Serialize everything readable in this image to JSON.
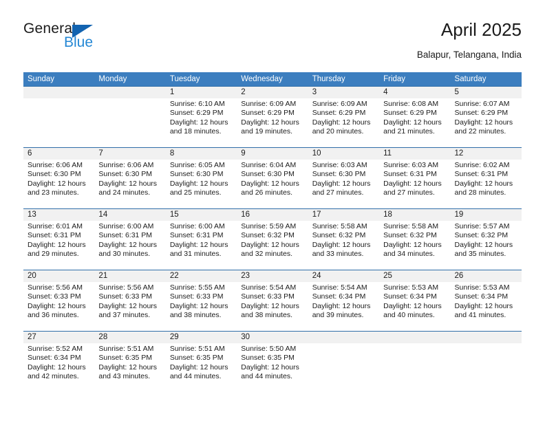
{
  "logo": {
    "word_one": "General",
    "word_two": "Blue",
    "triangle_color": "#1263b0",
    "blue_text_color": "#2487d4"
  },
  "header": {
    "title": "April 2025",
    "subtitle": "Balapur, Telangana, India"
  },
  "theme": {
    "header_blue": "#3c7ebf",
    "divider_blue": "#2f6da8",
    "number_band": "#f1f1f1",
    "text": "#1b1b1b"
  },
  "calendar": {
    "day_headers": [
      "Sunday",
      "Monday",
      "Tuesday",
      "Wednesday",
      "Thursday",
      "Friday",
      "Saturday"
    ],
    "weeks": [
      {
        "numbers": [
          "",
          "",
          "1",
          "2",
          "3",
          "4",
          "5"
        ],
        "cells": [
          {
            "sunrise": "",
            "sunset": "",
            "daylight_1": "",
            "daylight_2": ""
          },
          {
            "sunrise": "",
            "sunset": "",
            "daylight_1": "",
            "daylight_2": ""
          },
          {
            "sunrise": "Sunrise: 6:10 AM",
            "sunset": "Sunset: 6:29 PM",
            "daylight_1": "Daylight: 12 hours",
            "daylight_2": "and 18 minutes."
          },
          {
            "sunrise": "Sunrise: 6:09 AM",
            "sunset": "Sunset: 6:29 PM",
            "daylight_1": "Daylight: 12 hours",
            "daylight_2": "and 19 minutes."
          },
          {
            "sunrise": "Sunrise: 6:09 AM",
            "sunset": "Sunset: 6:29 PM",
            "daylight_1": "Daylight: 12 hours",
            "daylight_2": "and 20 minutes."
          },
          {
            "sunrise": "Sunrise: 6:08 AM",
            "sunset": "Sunset: 6:29 PM",
            "daylight_1": "Daylight: 12 hours",
            "daylight_2": "and 21 minutes."
          },
          {
            "sunrise": "Sunrise: 6:07 AM",
            "sunset": "Sunset: 6:29 PM",
            "daylight_1": "Daylight: 12 hours",
            "daylight_2": "and 22 minutes."
          }
        ]
      },
      {
        "numbers": [
          "6",
          "7",
          "8",
          "9",
          "10",
          "11",
          "12"
        ],
        "cells": [
          {
            "sunrise": "Sunrise: 6:06 AM",
            "sunset": "Sunset: 6:30 PM",
            "daylight_1": "Daylight: 12 hours",
            "daylight_2": "and 23 minutes."
          },
          {
            "sunrise": "Sunrise: 6:06 AM",
            "sunset": "Sunset: 6:30 PM",
            "daylight_1": "Daylight: 12 hours",
            "daylight_2": "and 24 minutes."
          },
          {
            "sunrise": "Sunrise: 6:05 AM",
            "sunset": "Sunset: 6:30 PM",
            "daylight_1": "Daylight: 12 hours",
            "daylight_2": "and 25 minutes."
          },
          {
            "sunrise": "Sunrise: 6:04 AM",
            "sunset": "Sunset: 6:30 PM",
            "daylight_1": "Daylight: 12 hours",
            "daylight_2": "and 26 minutes."
          },
          {
            "sunrise": "Sunrise: 6:03 AM",
            "sunset": "Sunset: 6:30 PM",
            "daylight_1": "Daylight: 12 hours",
            "daylight_2": "and 27 minutes."
          },
          {
            "sunrise": "Sunrise: 6:03 AM",
            "sunset": "Sunset: 6:31 PM",
            "daylight_1": "Daylight: 12 hours",
            "daylight_2": "and 27 minutes."
          },
          {
            "sunrise": "Sunrise: 6:02 AM",
            "sunset": "Sunset: 6:31 PM",
            "daylight_1": "Daylight: 12 hours",
            "daylight_2": "and 28 minutes."
          }
        ]
      },
      {
        "numbers": [
          "13",
          "14",
          "15",
          "16",
          "17",
          "18",
          "19"
        ],
        "cells": [
          {
            "sunrise": "Sunrise: 6:01 AM",
            "sunset": "Sunset: 6:31 PM",
            "daylight_1": "Daylight: 12 hours",
            "daylight_2": "and 29 minutes."
          },
          {
            "sunrise": "Sunrise: 6:00 AM",
            "sunset": "Sunset: 6:31 PM",
            "daylight_1": "Daylight: 12 hours",
            "daylight_2": "and 30 minutes."
          },
          {
            "sunrise": "Sunrise: 6:00 AM",
            "sunset": "Sunset: 6:31 PM",
            "daylight_1": "Daylight: 12 hours",
            "daylight_2": "and 31 minutes."
          },
          {
            "sunrise": "Sunrise: 5:59 AM",
            "sunset": "Sunset: 6:32 PM",
            "daylight_1": "Daylight: 12 hours",
            "daylight_2": "and 32 minutes."
          },
          {
            "sunrise": "Sunrise: 5:58 AM",
            "sunset": "Sunset: 6:32 PM",
            "daylight_1": "Daylight: 12 hours",
            "daylight_2": "and 33 minutes."
          },
          {
            "sunrise": "Sunrise: 5:58 AM",
            "sunset": "Sunset: 6:32 PM",
            "daylight_1": "Daylight: 12 hours",
            "daylight_2": "and 34 minutes."
          },
          {
            "sunrise": "Sunrise: 5:57 AM",
            "sunset": "Sunset: 6:32 PM",
            "daylight_1": "Daylight: 12 hours",
            "daylight_2": "and 35 minutes."
          }
        ]
      },
      {
        "numbers": [
          "20",
          "21",
          "22",
          "23",
          "24",
          "25",
          "26"
        ],
        "cells": [
          {
            "sunrise": "Sunrise: 5:56 AM",
            "sunset": "Sunset: 6:33 PM",
            "daylight_1": "Daylight: 12 hours",
            "daylight_2": "and 36 minutes."
          },
          {
            "sunrise": "Sunrise: 5:56 AM",
            "sunset": "Sunset: 6:33 PM",
            "daylight_1": "Daylight: 12 hours",
            "daylight_2": "and 37 minutes."
          },
          {
            "sunrise": "Sunrise: 5:55 AM",
            "sunset": "Sunset: 6:33 PM",
            "daylight_1": "Daylight: 12 hours",
            "daylight_2": "and 38 minutes."
          },
          {
            "sunrise": "Sunrise: 5:54 AM",
            "sunset": "Sunset: 6:33 PM",
            "daylight_1": "Daylight: 12 hours",
            "daylight_2": "and 38 minutes."
          },
          {
            "sunrise": "Sunrise: 5:54 AM",
            "sunset": "Sunset: 6:34 PM",
            "daylight_1": "Daylight: 12 hours",
            "daylight_2": "and 39 minutes."
          },
          {
            "sunrise": "Sunrise: 5:53 AM",
            "sunset": "Sunset: 6:34 PM",
            "daylight_1": "Daylight: 12 hours",
            "daylight_2": "and 40 minutes."
          },
          {
            "sunrise": "Sunrise: 5:53 AM",
            "sunset": "Sunset: 6:34 PM",
            "daylight_1": "Daylight: 12 hours",
            "daylight_2": "and 41 minutes."
          }
        ]
      },
      {
        "numbers": [
          "27",
          "28",
          "29",
          "30",
          "",
          "",
          ""
        ],
        "cells": [
          {
            "sunrise": "Sunrise: 5:52 AM",
            "sunset": "Sunset: 6:34 PM",
            "daylight_1": "Daylight: 12 hours",
            "daylight_2": "and 42 minutes."
          },
          {
            "sunrise": "Sunrise: 5:51 AM",
            "sunset": "Sunset: 6:35 PM",
            "daylight_1": "Daylight: 12 hours",
            "daylight_2": "and 43 minutes."
          },
          {
            "sunrise": "Sunrise: 5:51 AM",
            "sunset": "Sunset: 6:35 PM",
            "daylight_1": "Daylight: 12 hours",
            "daylight_2": "and 44 minutes."
          },
          {
            "sunrise": "Sunrise: 5:50 AM",
            "sunset": "Sunset: 6:35 PM",
            "daylight_1": "Daylight: 12 hours",
            "daylight_2": "and 44 minutes."
          },
          {
            "sunrise": "",
            "sunset": "",
            "daylight_1": "",
            "daylight_2": ""
          },
          {
            "sunrise": "",
            "sunset": "",
            "daylight_1": "",
            "daylight_2": ""
          },
          {
            "sunrise": "",
            "sunset": "",
            "daylight_1": "",
            "daylight_2": ""
          }
        ]
      }
    ]
  }
}
